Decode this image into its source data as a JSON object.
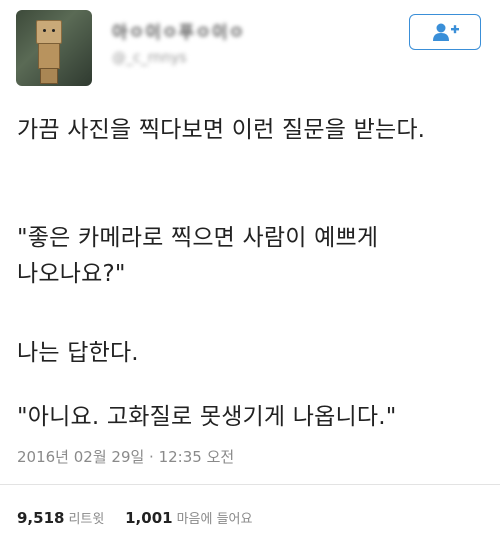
{
  "author": {
    "display_name": "아ㅇ이ㅇ푸ㅇ이ㅇ",
    "handle": "@_c_rnnys"
  },
  "follow_button": {
    "icon": "add-user-icon",
    "color": "#3a8fd8"
  },
  "tweet": {
    "lines": [
      "가끔 사진을 찍다보면 이런 질문을 받는다.",
      "\"좋은 카메라로 찍으면 사람이 예쁘게",
      "나오나요?\"",
      "나는 답한다.",
      "\"아니요. 고화질로 못생기게 나옵니다.\""
    ],
    "timestamp": "2016년 02월 29일 · 12:35 오전"
  },
  "stats": {
    "retweets": {
      "count": "9,518",
      "label": "리트윗"
    },
    "likes": {
      "count": "1,001",
      "label": "마음에 들어요"
    }
  }
}
